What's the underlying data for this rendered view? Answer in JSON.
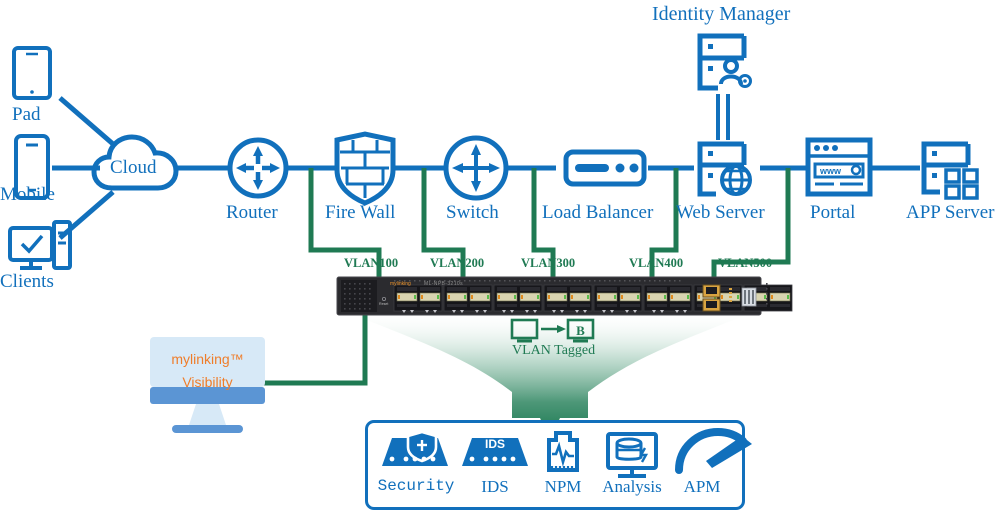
{
  "diagram": {
    "title_top": "Identity Manager",
    "colors": {
      "blue": "#1170bc",
      "green": "#1f7a53",
      "orange": "#ef7d2a",
      "screen": "#d7e9f7",
      "screen_base": "#5b95d4",
      "switch_body": "#2b2b2f"
    }
  },
  "endpoints": [
    {
      "id": "pad",
      "label": "Pad",
      "icon": "tablet-icon"
    },
    {
      "id": "mobile",
      "label": "Mobile",
      "icon": "smartphone-icon"
    },
    {
      "id": "clients",
      "label": "Clients",
      "icon": "desktop-client-icon"
    }
  ],
  "chain": [
    {
      "id": "cloud",
      "label": "Cloud",
      "icon": "cloud-icon"
    },
    {
      "id": "router",
      "label": "Router",
      "icon": "router-icon"
    },
    {
      "id": "firewall",
      "label": "Fire Wall",
      "icon": "firewall-shield-icon"
    },
    {
      "id": "switch",
      "label": "Switch",
      "icon": "switch-icon"
    },
    {
      "id": "loadbalancer",
      "label": "Load Balancer",
      "icon": "load-balancer-icon"
    },
    {
      "id": "webserver",
      "label": "Web Server",
      "icon": "web-server-icon"
    },
    {
      "id": "portal",
      "label": "Portal",
      "icon": "portal-browser-icon"
    },
    {
      "id": "appserver",
      "label": "APP Server",
      "icon": "app-server-icon"
    }
  ],
  "identity_manager": {
    "label": "Identity Manager",
    "icon": "identity-manager-icon"
  },
  "vlans": [
    {
      "label": "VLAN100"
    },
    {
      "label": "VLAN200"
    },
    {
      "label": "VLAN300"
    },
    {
      "label": "VLAN400"
    },
    {
      "label": "VLAN500"
    }
  ],
  "network_packet_broker": {
    "brand": "mylinking",
    "model": "ML-NPB-3210s",
    "reset_label": "Reset",
    "port_groups": 8,
    "icon": "network-packet-broker-icon"
  },
  "vlan_tagged": {
    "label": "VLAN Tagged",
    "tag_letter": "B",
    "icon": "vlan-tagged-icon"
  },
  "monitor": {
    "line1": "mylinking™",
    "line2": "Visibility",
    "icon": "visibility-monitor-icon"
  },
  "tools": [
    {
      "label": "Security",
      "icon": "security-appliance-icon",
      "mono": true
    },
    {
      "label": "IDS",
      "icon": "ids-appliance-icon",
      "mono": false
    },
    {
      "label": "NPM",
      "icon": "npm-waveform-icon",
      "mono": false
    },
    {
      "label": "Analysis",
      "icon": "analysis-database-icon",
      "mono": false
    },
    {
      "label": "APM",
      "icon": "apm-gauge-icon",
      "mono": false
    }
  ]
}
